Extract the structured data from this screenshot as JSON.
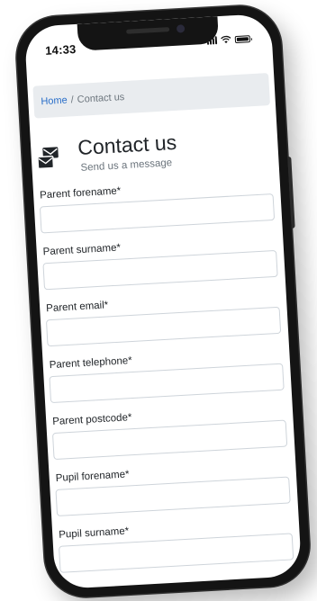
{
  "status_bar": {
    "time": "14:33"
  },
  "breadcrumb": {
    "home": "Home",
    "separator": "/",
    "current": "Contact us"
  },
  "header": {
    "icon": "envelope-stack-icon",
    "title": "Contact us",
    "subtitle": "Send us a message"
  },
  "form": {
    "fields": [
      {
        "label": "Parent forename*",
        "value": ""
      },
      {
        "label": "Parent surname*",
        "value": ""
      },
      {
        "label": "Parent email*",
        "value": ""
      },
      {
        "label": "Parent telephone*",
        "value": ""
      },
      {
        "label": "Parent postcode*",
        "value": ""
      },
      {
        "label": "Pupil forename*",
        "value": ""
      },
      {
        "label": "Pupil surname*",
        "value": ""
      }
    ]
  },
  "colors": {
    "link": "#2a6fc9",
    "breadcrumb_bg": "#e9ecef",
    "text": "#212529",
    "muted": "#6c757d",
    "border": "#ced4da",
    "phone": "#141414"
  }
}
